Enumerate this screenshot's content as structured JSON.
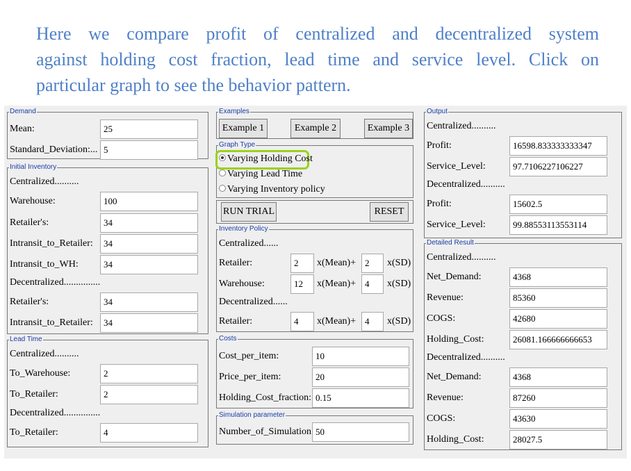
{
  "headline": {
    "line1": "Here we compare profit of centralized and decentralized system",
    "line2": "against holding cost fraction, lead time and service level. Click on",
    "line3": "particular graph to see the behavior pattern."
  },
  "demand": {
    "legend": "Demand",
    "mean_label": "Mean:",
    "mean_value": "25",
    "sd_label": "Standard_Deviation:...",
    "sd_value": "5"
  },
  "initial_inventory": {
    "legend": "Initial Inventory",
    "centralized_label": "Centralized..........",
    "warehouse_label": "Warehouse:",
    "warehouse_value": "100",
    "retailers_label": "Retailer's:",
    "retailers_value": "34",
    "intransit_retailer_label": "Intransit_to_Retailer:",
    "intransit_retailer_value": "34",
    "intransit_wh_label": "Intransit_to_WH:",
    "intransit_wh_value": "34",
    "decentralized_label": "Decentralized...............",
    "dec_retailers_label": "Retailer's:",
    "dec_retailers_value": "34",
    "dec_intransit_label": "Intransit_to_Retailer:",
    "dec_intransit_value": "34"
  },
  "lead_time": {
    "legend": "Lead Time",
    "centralized_label": "Centralized..........",
    "to_warehouse_label": "To_Warehouse:",
    "to_warehouse_value": "2",
    "to_retailer_label": "To_Retailer:",
    "to_retailer_value": "2",
    "decentralized_label": "Decentralized...............",
    "dec_to_retailer_label": "To_Retailer:",
    "dec_to_retailer_value": "4"
  },
  "examples": {
    "legend": "Examples",
    "ex1": "Example 1",
    "ex2": "Example 2",
    "ex3": "Example 3"
  },
  "graph_type": {
    "legend": "Graph Type",
    "opt1": "Varying Holding Cost",
    "opt2": "Varying Lead Time",
    "opt3": "Varying Inventory policy",
    "selected": "Varying Holding Cost"
  },
  "actions": {
    "run": "RUN TRIAL",
    "reset": "RESET"
  },
  "inventory_policy": {
    "legend": "Inventory Policy",
    "centralized_label": "Centralized......",
    "retailer_label": "Retailer:",
    "retailer_mean": "2",
    "retailer_sd": "2",
    "warehouse_label": "Warehouse:",
    "warehouse_mean": "12",
    "warehouse_sd": "4",
    "decentralized_label": "Decentralized......",
    "dec_retailer_label": "Retailer:",
    "dec_retailer_mean": "4",
    "dec_retailer_sd": "4",
    "mean_suffix": "x(Mean)+",
    "sd_suffix": "x(SD)"
  },
  "costs": {
    "legend": "Costs",
    "cost_label": "Cost_per_item:",
    "cost_value": "10",
    "price_label": "Price_per_item:",
    "price_value": "20",
    "holding_label": "Holding_Cost_fraction:.",
    "holding_value": "0.15"
  },
  "simulation": {
    "legend": "Simulation parameter",
    "num_label": "Number_of_Simulation:",
    "num_value": "50"
  },
  "output": {
    "legend": "Output",
    "centralized_label": "Centralized..........",
    "profit_label": "Profit:",
    "profit_value": "16598.833333333347",
    "service_label": "Service_Level:",
    "service_value": "97.7106227106227",
    "decentralized_label": "Decentralized..........",
    "dec_profit_label": "Profit:",
    "dec_profit_value": "15602.5",
    "dec_service_label": "Service_Level:",
    "dec_service_value": "99.88553113553114"
  },
  "detailed": {
    "legend": "Detailed Result",
    "centralized_label": "Centralized..........",
    "net_demand_label": "Net_Demand:",
    "net_demand_value": "4368",
    "revenue_label": "Revenue:",
    "revenue_value": "85360",
    "cogs_label": "COGS:",
    "cogs_value": "42680",
    "holding_label": "Holding_Cost:",
    "holding_value": "26081.166666666653",
    "decentralized_label": "Decentralized..........",
    "dec_net_demand_label": "Net_Demand:",
    "dec_net_demand_value": "4368",
    "dec_revenue_label": "Revenue:",
    "dec_revenue_value": "87260",
    "dec_cogs_label": "COGS:",
    "dec_cogs_value": "43630",
    "dec_holding_label": "Holding_Cost:",
    "dec_holding_value": "28027.5"
  },
  "colors": {
    "headline": "#4f80c8",
    "legend": "#1a3ea6",
    "panel_bg": "#efefef",
    "highlight": "#9ad21b"
  }
}
